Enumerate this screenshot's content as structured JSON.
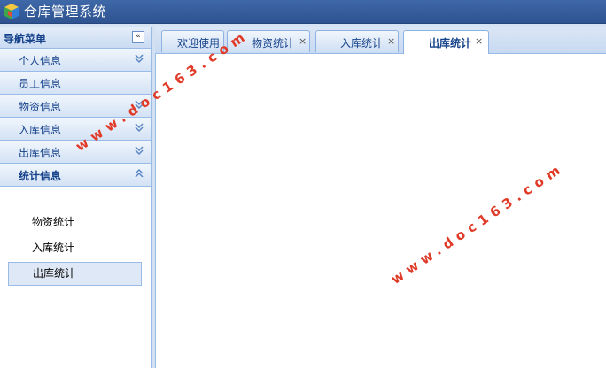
{
  "app": {
    "title": "仓库管理系统",
    "logo_icon": "cube-logo-icon"
  },
  "sidebar": {
    "title": "导航菜单",
    "collapse_icon": "double-chevron-left-icon",
    "sections": [
      {
        "label": "个人信息",
        "state": "collapsed"
      },
      {
        "label": "员工信息",
        "state": "collapsed"
      },
      {
        "label": "物资信息",
        "state": "collapsed"
      },
      {
        "label": "入库信息",
        "state": "collapsed"
      },
      {
        "label": "出库信息",
        "state": "collapsed"
      },
      {
        "label": "统计信息",
        "state": "expanded"
      }
    ],
    "sub_items": [
      "物资统计",
      "入库统计",
      "出库统计"
    ],
    "selected_sub_item": "出库统计"
  },
  "tabs": [
    {
      "label": "欢迎使用",
      "closable": false
    },
    {
      "label": "物资统计",
      "closable": true,
      "close": "×"
    },
    {
      "label": "入库统计",
      "closable": true,
      "close": "×"
    },
    {
      "label": "出库统计",
      "closable": true,
      "close": "×",
      "active": true
    }
  ],
  "watermark": {
    "text": "www.doc163.com"
  },
  "colors": {
    "header": "#3f68a8",
    "border": "#99bbe8",
    "label": "#15428b",
    "watermark": "#e03b28"
  }
}
